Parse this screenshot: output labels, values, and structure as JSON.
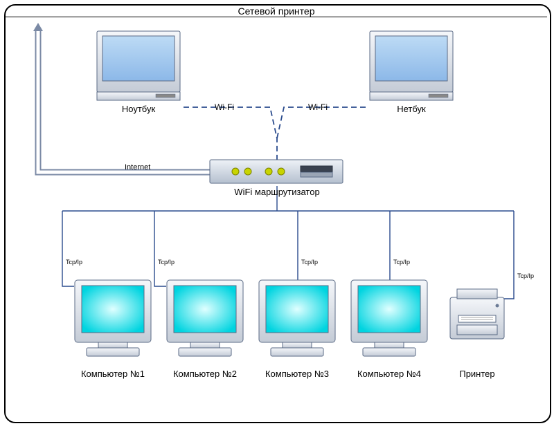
{
  "title": "Сетевой принтер",
  "labels": {
    "laptop": "Ноутбук",
    "netbook": "Нетбук",
    "wifi1": "Wi-Fi",
    "wifi2": "Wi-Fi",
    "internet": "Internet",
    "router": "WiFi маршрутизатор",
    "tcp1": "Tcp/Ip",
    "tcp2": "Tcp/Ip",
    "tcp3": "Tcp/Ip",
    "tcp4": "Tcp/Ip",
    "tcp5": "Tcp/Ip",
    "pc1": "Компьютер №1",
    "pc2": "Компьютер №2",
    "pc3": "Компьютер №3",
    "pc4": "Компьютер №4",
    "printer": "Принтер"
  }
}
